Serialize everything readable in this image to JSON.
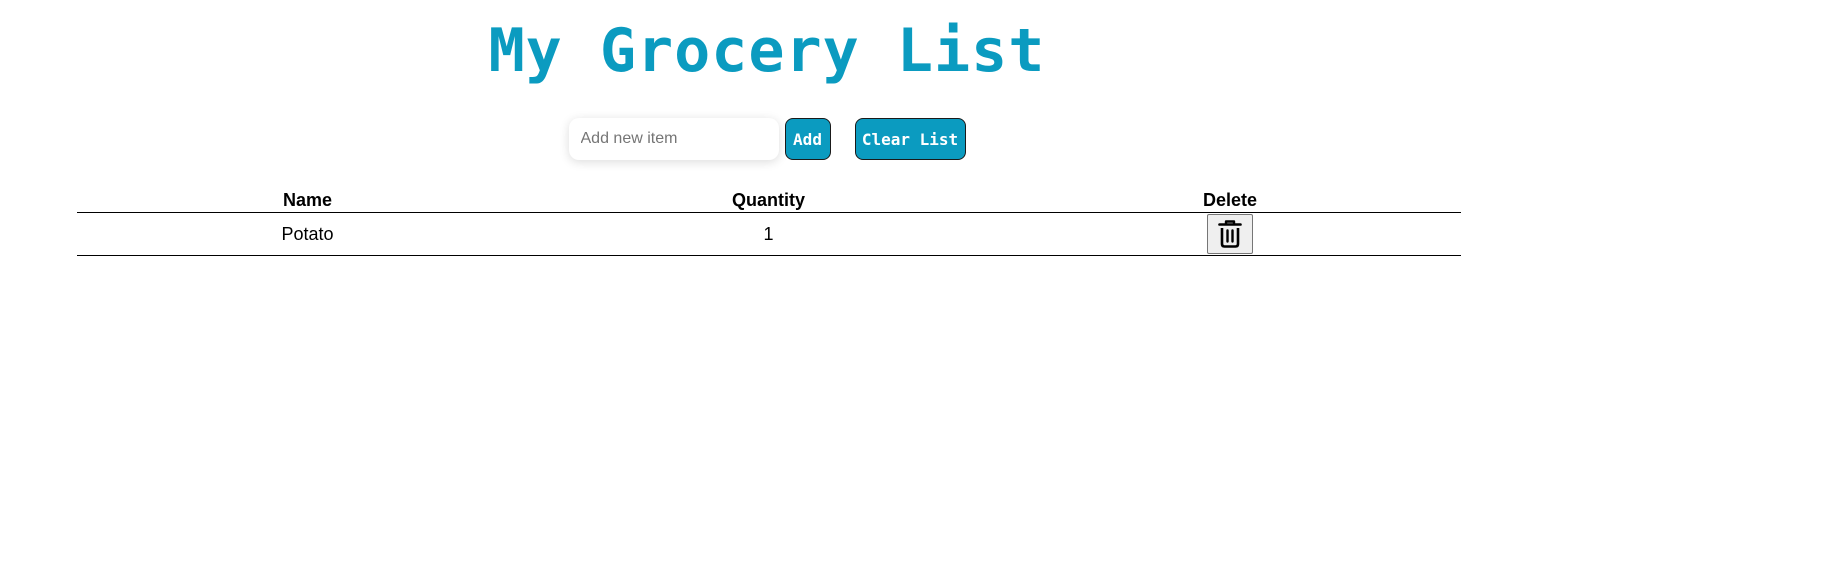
{
  "app": {
    "title": "My Grocery List"
  },
  "controls": {
    "input_value": "",
    "input_placeholder": "Add new item",
    "add_label": "Add",
    "clear_label": "Clear List"
  },
  "table": {
    "headers": {
      "name": "Name",
      "quantity": "Quantity",
      "delete": "Delete"
    },
    "rows": [
      {
        "name": "Potato",
        "quantity": "1",
        "delete_icon": "trash-icon"
      }
    ]
  },
  "colors": {
    "accent": "#0b9bc0",
    "button_text": "#ffffff",
    "border": "#000000"
  }
}
